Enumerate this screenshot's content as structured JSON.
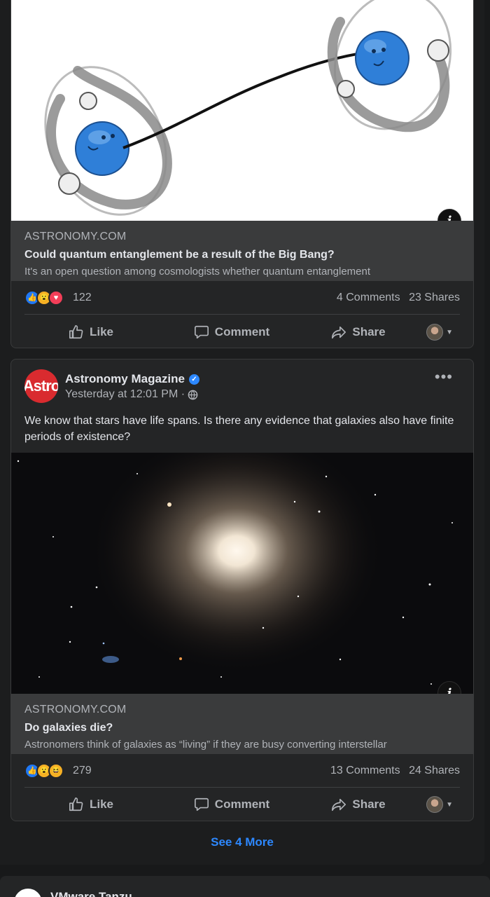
{
  "posts": [
    {
      "link": {
        "domain": "ASTRONOMY.COM",
        "title": "Could quantum entanglement be a result of the Big Bang?",
        "description": "It's an open question among cosmologists whether quantum entanglement"
      },
      "reactions": {
        "icons": [
          "like-icon",
          "wow-icon",
          "love-icon"
        ],
        "count": "122",
        "comments": "4 Comments",
        "shares": "23 Shares"
      },
      "actions": {
        "like": "Like",
        "comment": "Comment",
        "share": "Share"
      }
    },
    {
      "page_name": "Astronomy Magazine",
      "avatar_text": "Astro",
      "timestamp": "Yesterday at 12:01 PM ·",
      "text": "We know that stars have life spans. Is there any evidence that galaxies also have finite periods of existence?",
      "link": {
        "domain": "ASTRONOMY.COM",
        "title": "Do galaxies die?",
        "description": "Astronomers think of galaxies as “living” if they are busy converting interstellar"
      },
      "reactions": {
        "icons": [
          "like-icon",
          "wow-icon",
          "haha-icon"
        ],
        "count": "279",
        "comments": "13 Comments",
        "shares": "24 Shares"
      },
      "actions": {
        "like": "Like",
        "comment": "Comment",
        "share": "Share"
      }
    }
  ],
  "see_more": "See 4 More",
  "next_post": {
    "page_name": "VMware Tanzu"
  },
  "colors": {
    "accent": "#2d88ff",
    "card": "#242526",
    "background": "#18191a",
    "link_box": "#3a3b3c"
  }
}
